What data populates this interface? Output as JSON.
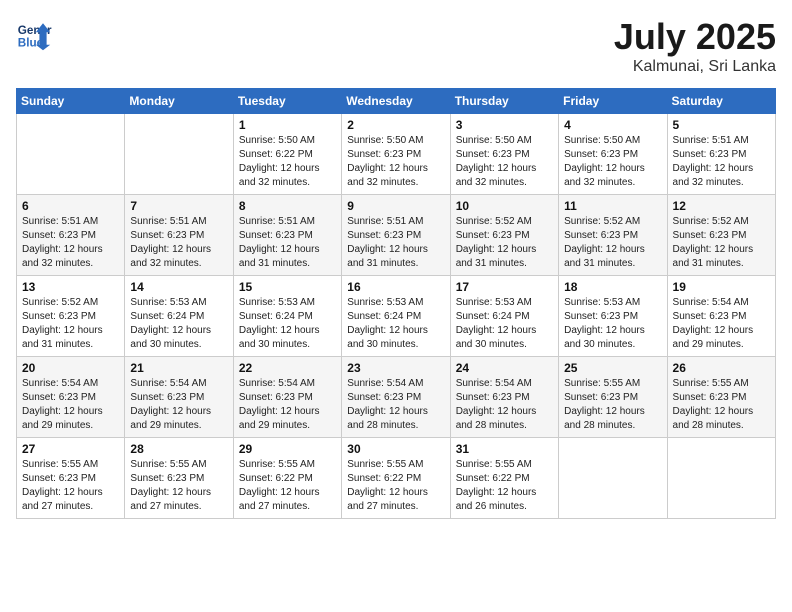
{
  "header": {
    "logo_line1": "General",
    "logo_line2": "Blue",
    "month": "July 2025",
    "location": "Kalmunai, Sri Lanka"
  },
  "weekdays": [
    "Sunday",
    "Monday",
    "Tuesday",
    "Wednesday",
    "Thursday",
    "Friday",
    "Saturday"
  ],
  "weeks": [
    [
      {
        "day": "",
        "info": ""
      },
      {
        "day": "",
        "info": ""
      },
      {
        "day": "1",
        "sunrise": "5:50 AM",
        "sunset": "6:22 PM",
        "daylight": "12 hours and 32 minutes."
      },
      {
        "day": "2",
        "sunrise": "5:50 AM",
        "sunset": "6:23 PM",
        "daylight": "12 hours and 32 minutes."
      },
      {
        "day": "3",
        "sunrise": "5:50 AM",
        "sunset": "6:23 PM",
        "daylight": "12 hours and 32 minutes."
      },
      {
        "day": "4",
        "sunrise": "5:50 AM",
        "sunset": "6:23 PM",
        "daylight": "12 hours and 32 minutes."
      },
      {
        "day": "5",
        "sunrise": "5:51 AM",
        "sunset": "6:23 PM",
        "daylight": "12 hours and 32 minutes."
      }
    ],
    [
      {
        "day": "6",
        "sunrise": "5:51 AM",
        "sunset": "6:23 PM",
        "daylight": "12 hours and 32 minutes."
      },
      {
        "day": "7",
        "sunrise": "5:51 AM",
        "sunset": "6:23 PM",
        "daylight": "12 hours and 32 minutes."
      },
      {
        "day": "8",
        "sunrise": "5:51 AM",
        "sunset": "6:23 PM",
        "daylight": "12 hours and 31 minutes."
      },
      {
        "day": "9",
        "sunrise": "5:51 AM",
        "sunset": "6:23 PM",
        "daylight": "12 hours and 31 minutes."
      },
      {
        "day": "10",
        "sunrise": "5:52 AM",
        "sunset": "6:23 PM",
        "daylight": "12 hours and 31 minutes."
      },
      {
        "day": "11",
        "sunrise": "5:52 AM",
        "sunset": "6:23 PM",
        "daylight": "12 hours and 31 minutes."
      },
      {
        "day": "12",
        "sunrise": "5:52 AM",
        "sunset": "6:23 PM",
        "daylight": "12 hours and 31 minutes."
      }
    ],
    [
      {
        "day": "13",
        "sunrise": "5:52 AM",
        "sunset": "6:23 PM",
        "daylight": "12 hours and 31 minutes."
      },
      {
        "day": "14",
        "sunrise": "5:53 AM",
        "sunset": "6:24 PM",
        "daylight": "12 hours and 30 minutes."
      },
      {
        "day": "15",
        "sunrise": "5:53 AM",
        "sunset": "6:24 PM",
        "daylight": "12 hours and 30 minutes."
      },
      {
        "day": "16",
        "sunrise": "5:53 AM",
        "sunset": "6:24 PM",
        "daylight": "12 hours and 30 minutes."
      },
      {
        "day": "17",
        "sunrise": "5:53 AM",
        "sunset": "6:24 PM",
        "daylight": "12 hours and 30 minutes."
      },
      {
        "day": "18",
        "sunrise": "5:53 AM",
        "sunset": "6:23 PM",
        "daylight": "12 hours and 30 minutes."
      },
      {
        "day": "19",
        "sunrise": "5:54 AM",
        "sunset": "6:23 PM",
        "daylight": "12 hours and 29 minutes."
      }
    ],
    [
      {
        "day": "20",
        "sunrise": "5:54 AM",
        "sunset": "6:23 PM",
        "daylight": "12 hours and 29 minutes."
      },
      {
        "day": "21",
        "sunrise": "5:54 AM",
        "sunset": "6:23 PM",
        "daylight": "12 hours and 29 minutes."
      },
      {
        "day": "22",
        "sunrise": "5:54 AM",
        "sunset": "6:23 PM",
        "daylight": "12 hours and 29 minutes."
      },
      {
        "day": "23",
        "sunrise": "5:54 AM",
        "sunset": "6:23 PM",
        "daylight": "12 hours and 28 minutes."
      },
      {
        "day": "24",
        "sunrise": "5:54 AM",
        "sunset": "6:23 PM",
        "daylight": "12 hours and 28 minutes."
      },
      {
        "day": "25",
        "sunrise": "5:55 AM",
        "sunset": "6:23 PM",
        "daylight": "12 hours and 28 minutes."
      },
      {
        "day": "26",
        "sunrise": "5:55 AM",
        "sunset": "6:23 PM",
        "daylight": "12 hours and 28 minutes."
      }
    ],
    [
      {
        "day": "27",
        "sunrise": "5:55 AM",
        "sunset": "6:23 PM",
        "daylight": "12 hours and 27 minutes."
      },
      {
        "day": "28",
        "sunrise": "5:55 AM",
        "sunset": "6:23 PM",
        "daylight": "12 hours and 27 minutes."
      },
      {
        "day": "29",
        "sunrise": "5:55 AM",
        "sunset": "6:22 PM",
        "daylight": "12 hours and 27 minutes."
      },
      {
        "day": "30",
        "sunrise": "5:55 AM",
        "sunset": "6:22 PM",
        "daylight": "12 hours and 27 minutes."
      },
      {
        "day": "31",
        "sunrise": "5:55 AM",
        "sunset": "6:22 PM",
        "daylight": "12 hours and 26 minutes."
      },
      {
        "day": "",
        "info": ""
      },
      {
        "day": "",
        "info": ""
      }
    ]
  ],
  "labels": {
    "sunrise": "Sunrise:",
    "sunset": "Sunset:",
    "daylight": "Daylight:"
  }
}
